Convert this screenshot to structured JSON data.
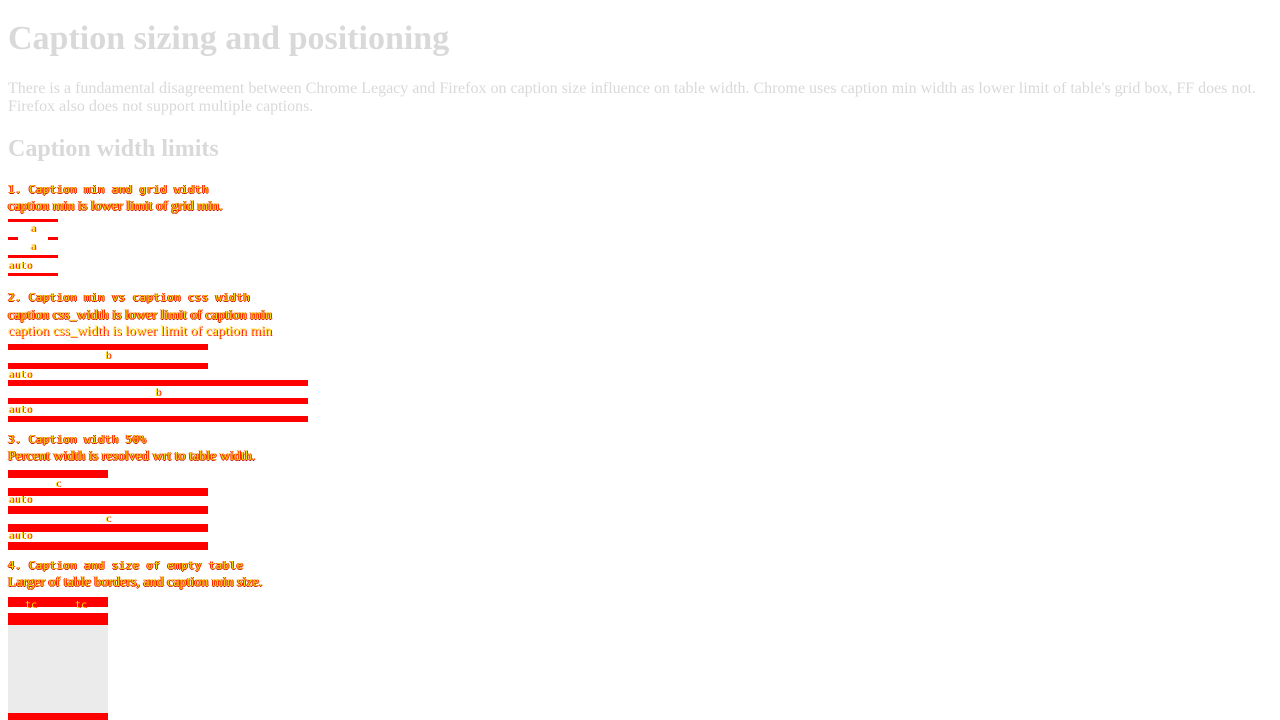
{
  "page": {
    "title": "Caption sizing and positioning",
    "intro": "There is a fundamental disagreement between Chrome Legacy and Firefox on caption size influence on table width. Chrome uses caption min width as lower limit of table's grid box, FF does not. Firefox also does not support multiple captions.",
    "section_title": "Caption width limits"
  },
  "tests": [
    {
      "heading": "1. Caption min and grid width",
      "description": "caption min is lower limit of grid min.",
      "cells": [
        "a",
        "a"
      ],
      "caption_text": "auto"
    },
    {
      "heading": "2. Caption min vs caption css width",
      "description": "caption css_width is lower limit of caption min",
      "cells": [
        "b",
        "b"
      ],
      "caption_text": "auto"
    },
    {
      "heading": "3. Caption width 50%",
      "description": "Percent width is resolved wrt to table width.",
      "cells": [
        "c",
        "c"
      ],
      "caption_text": "auto"
    },
    {
      "heading": "4. Caption and size of empty table",
      "description": "Larger of table borders, and caption min size.",
      "cells": [
        "tc",
        "tc"
      ]
    }
  ]
}
